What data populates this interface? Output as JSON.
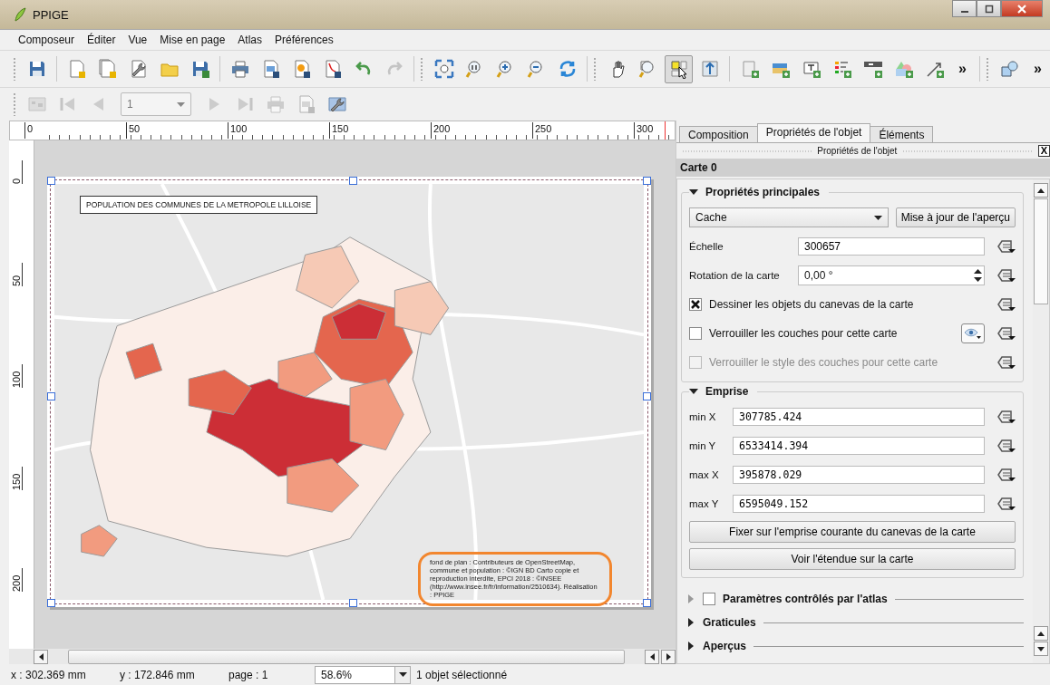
{
  "window": {
    "title": "PPIGE"
  },
  "menu": [
    "Composeur",
    "Éditer",
    "Vue",
    "Mise en page",
    "Atlas",
    "Préférences"
  ],
  "main_toolbar": {
    "buttons": [
      {
        "selected": false,
        "disabled": false
      },
      {
        "selected": false,
        "disabled": false
      },
      {
        "selected": false,
        "disabled": false
      },
      {
        "selected": false,
        "disabled": false
      },
      {
        "selected": false,
        "disabled": false
      },
      {
        "selected": false,
        "disabled": false
      },
      {
        "selected": false,
        "disabled": false
      },
      {
        "selected": false,
        "disabled": false
      },
      {
        "selected": false,
        "disabled": false
      },
      {
        "selected": false,
        "disabled": false
      },
      {
        "selected": false,
        "disabled": false
      },
      {
        "selected": false,
        "disabled": true
      },
      {
        "selected": false,
        "disabled": false
      },
      {
        "selected": false,
        "disabled": false
      },
      {
        "selected": false,
        "disabled": false
      },
      {
        "selected": false,
        "disabled": false
      },
      {
        "selected": false,
        "disabled": false
      },
      {
        "selected": false,
        "disabled": false
      },
      {
        "selected": false,
        "disabled": false
      },
      {
        "selected": true,
        "disabled": false
      },
      {
        "selected": false,
        "disabled": false
      },
      {
        "selected": false,
        "disabled": false
      },
      {
        "selected": false,
        "disabled": false
      },
      {
        "selected": false,
        "disabled": false
      },
      {
        "selected": false,
        "disabled": false
      },
      {
        "selected": false,
        "disabled": false
      },
      {
        "selected": false,
        "disabled": false
      },
      {
        "selected": false,
        "disabled": false
      },
      {
        "selected": false,
        "disabled": false
      }
    ],
    "overflow": [
      "»",
      "»"
    ]
  },
  "atlas_toolbar": {
    "buttons": [
      {
        "disabled": true
      },
      {
        "disabled": true
      },
      {
        "disabled": true
      },
      {
        "disabled": true
      },
      {
        "disabled": true
      },
      {
        "disabled": true
      },
      {
        "disabled": true
      },
      {
        "disabled": false
      }
    ],
    "page_value": "1"
  },
  "ruler": {
    "horizontal": [
      "0",
      "50",
      "100",
      "150",
      "200",
      "250",
      "300"
    ],
    "vertical": [
      "0",
      "50",
      "100",
      "150",
      "200"
    ]
  },
  "layout": {
    "map_title": "POPULATION DES COMMUNES DE LA METROPOLE LILLOISE",
    "attribution": "fond de plan : Contributeurs de OpenStreetMap, commune et population : ©IGN BD Carto copie et reproduction interdite, EPCI 2018 : ©INSEE (http://www.insee.fr/fr/information/2510634). Réalisation : PPIGE",
    "attribution_highlighted": true
  },
  "panel": {
    "tabs": [
      {
        "label": "Composition",
        "selected": false
      },
      {
        "label": "Propriétés de l'objet",
        "selected": true
      },
      {
        "label": "Éléments",
        "selected": false
      }
    ],
    "dock_title": "Propriétés de l'objet",
    "close": "X",
    "item_title": "Carte 0",
    "main_group": {
      "title": "Propriétés principales",
      "expanded": true,
      "cache_mode": "Cache",
      "update_button": "Mise à jour de l'aperçu",
      "scale_label": "Échelle",
      "scale": "300657",
      "rotation_label": "Rotation de la carte",
      "rotation": "0,00 °",
      "checkboxes": [
        {
          "label": "Dessiner les objets du canevas de la carte",
          "checked": true,
          "disabled": false
        },
        {
          "label": "Verrouiller les couches pour cette carte",
          "checked": false,
          "disabled": false
        },
        {
          "label": "Verrouiller le style des couches pour cette carte",
          "checked": false,
          "disabled": true
        }
      ]
    },
    "extent_group": {
      "title": "Emprise",
      "expanded": true,
      "fields": [
        {
          "label": "min X",
          "value": "307785.424"
        },
        {
          "label": "min Y",
          "value": "6533414.394"
        },
        {
          "label": "max X",
          "value": "395878.029"
        },
        {
          "label": "max Y",
          "value": "6595049.152"
        }
      ],
      "buttons": [
        "Fixer sur l'emprise courante du canevas de la carte",
        "Voir l'étendue sur la carte"
      ]
    },
    "collapsed_groups": [
      {
        "title": "Paramètres contrôlés par l'atlas",
        "kind": "checkable",
        "checked": false,
        "expanded": false
      },
      {
        "title": "Graticules",
        "kind": "plain",
        "expanded": false
      },
      {
        "title": "Aperçus",
        "kind": "plain",
        "expanded": false
      }
    ]
  },
  "status_bar": {
    "x": "x : 302.369 mm",
    "y": "y : 172.846 mm",
    "page": "page : 1",
    "zoom": "58.6%",
    "selection": "1 objet sélectionné"
  }
}
